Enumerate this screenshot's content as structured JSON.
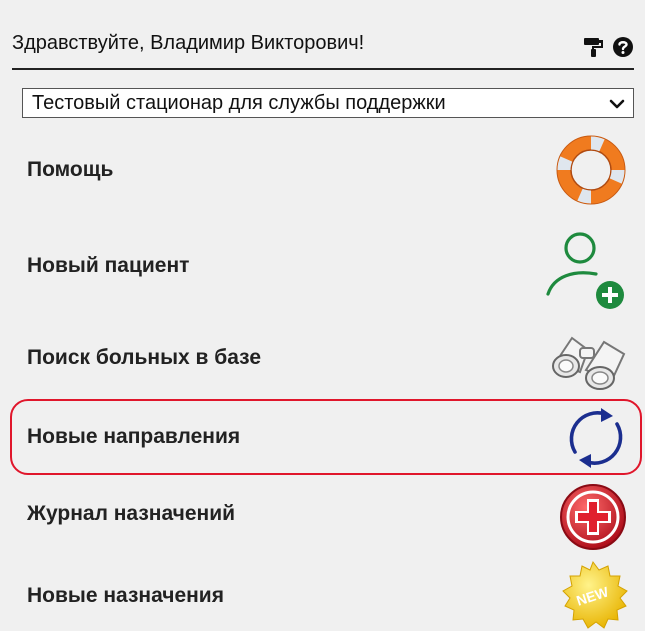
{
  "header": {
    "greeting": "Здравствуйте, Владимир Викторович!",
    "icons": [
      "paint-roller-icon",
      "help-icon"
    ]
  },
  "facility_select": {
    "value": "Тестовый стационар для службы поддержки"
  },
  "menu": {
    "items": [
      {
        "label": "Помощь",
        "icon": "lifebuoy-icon"
      },
      {
        "label": "Новый пациент",
        "icon": "add-user-icon"
      },
      {
        "label": "Поиск больных в базе",
        "icon": "binoculars-icon"
      },
      {
        "label": "Новые направления",
        "icon": "refresh-arrows-icon",
        "highlighted": true
      },
      {
        "label": "Журнал назначений",
        "icon": "red-cross-icon"
      },
      {
        "label": "Новые назначения",
        "icon": "new-badge-icon",
        "badge_text": "NEW"
      }
    ]
  },
  "colors": {
    "background": "#f0f0f0",
    "highlight_border": "#e0162b",
    "user_icon": "#1e8a3e",
    "refresh_icon": "#1b2e8f"
  }
}
